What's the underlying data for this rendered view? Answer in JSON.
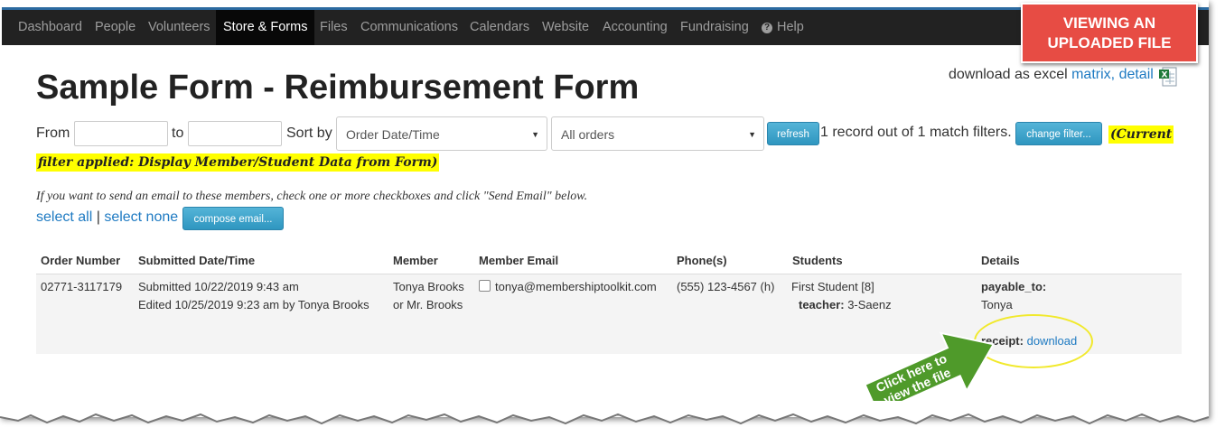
{
  "nav": {
    "items": [
      {
        "label": "Dashboard",
        "active": false
      },
      {
        "label": "People",
        "active": false
      },
      {
        "label": "Volunteers",
        "active": false
      },
      {
        "label": "Store & Forms",
        "active": true
      },
      {
        "label": "Files",
        "active": false
      },
      {
        "label": "Communications",
        "active": false
      },
      {
        "label": "Calendars",
        "active": false
      },
      {
        "label": "Website",
        "active": false
      },
      {
        "label": "Accounting",
        "active": false
      },
      {
        "label": "Fundraising",
        "active": false
      }
    ],
    "help_label": "Help",
    "help_icon": "question-circle-icon"
  },
  "callout": {
    "line1": "VIEWING AN",
    "line2": "UPLOADED FILE",
    "color": "#e74c44"
  },
  "page_title": "Sample Form - Reimbursement Form",
  "excel": {
    "prefix": "download as excel",
    "matrix": "matrix",
    "comma": ",",
    "detail": "detail",
    "icon": "excel-icon"
  },
  "filters": {
    "from_label": "From",
    "from_value": "",
    "to_label": "to",
    "to_value": "",
    "sort_label": "Sort by",
    "sort_selected": "Order Date/Time",
    "orders_selected": "All orders",
    "refresh_label": "refresh",
    "records_text": "1 record out of 1 match filters.",
    "change_filter_label": "change filter...",
    "applied_part1": "(Current",
    "applied_part2": "filter applied: Display Member/Student Data from Form)"
  },
  "email": {
    "instructions": "If you want to send an email to these members, check one or more checkboxes and click \"Send Email\" below.",
    "select_all": "select all",
    "separator": "|",
    "select_none": "select none",
    "compose_label": "compose email..."
  },
  "table": {
    "headers": [
      "Order Number",
      "Submitted Date/Time",
      "Member",
      "Member Email",
      "Phone(s)",
      "Students",
      "Details"
    ],
    "row": {
      "order_number": "02771-3117179",
      "submitted": "Submitted 10/22/2019 9:43 am",
      "edited": "Edited 10/25/2019 9:23 am by Tonya Brooks",
      "member_name": "Tonya Brooks",
      "member_alt": "or Mr. Brooks",
      "email": "tonya@membershiptoolkit.com",
      "phone": "(555) 123-4567 (h)",
      "student": "First Student [8]",
      "teacher_label": "teacher:",
      "teacher_value": "3-Saenz",
      "payable_label": "payable_to:",
      "payable_value": "Tonya",
      "receipt_label": "receipt:",
      "receipt_link": "download"
    }
  },
  "annotation": {
    "arrow_line1": "Click here to",
    "arrow_line2": "view the file",
    "arrow_color": "#4f9a2a",
    "ellipse_color": "#f1e92c"
  }
}
